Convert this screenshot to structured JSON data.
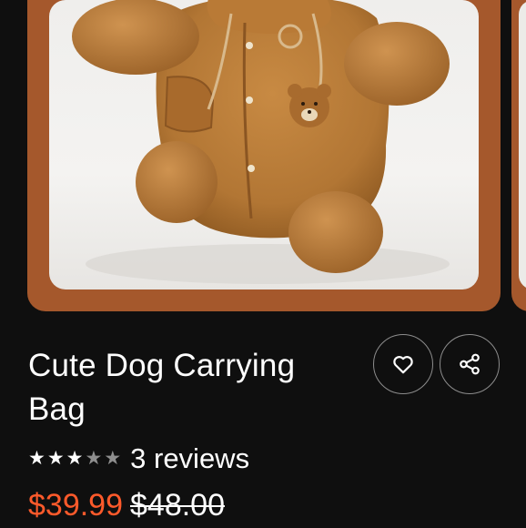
{
  "product": {
    "title": "Cute Dog Carrying Bag",
    "rating": {
      "filled_stars": 3,
      "total_stars": 5,
      "reviews_label": "3 reviews"
    },
    "price": {
      "current": "$39.99",
      "original": "$48.00"
    }
  },
  "actions": {
    "favorite_icon": "heart-icon",
    "share_icon": "share-icon"
  },
  "colors": {
    "card_border": "#a5582c",
    "sale_price": "#ff5a2b",
    "background": "#0f0f0f"
  }
}
